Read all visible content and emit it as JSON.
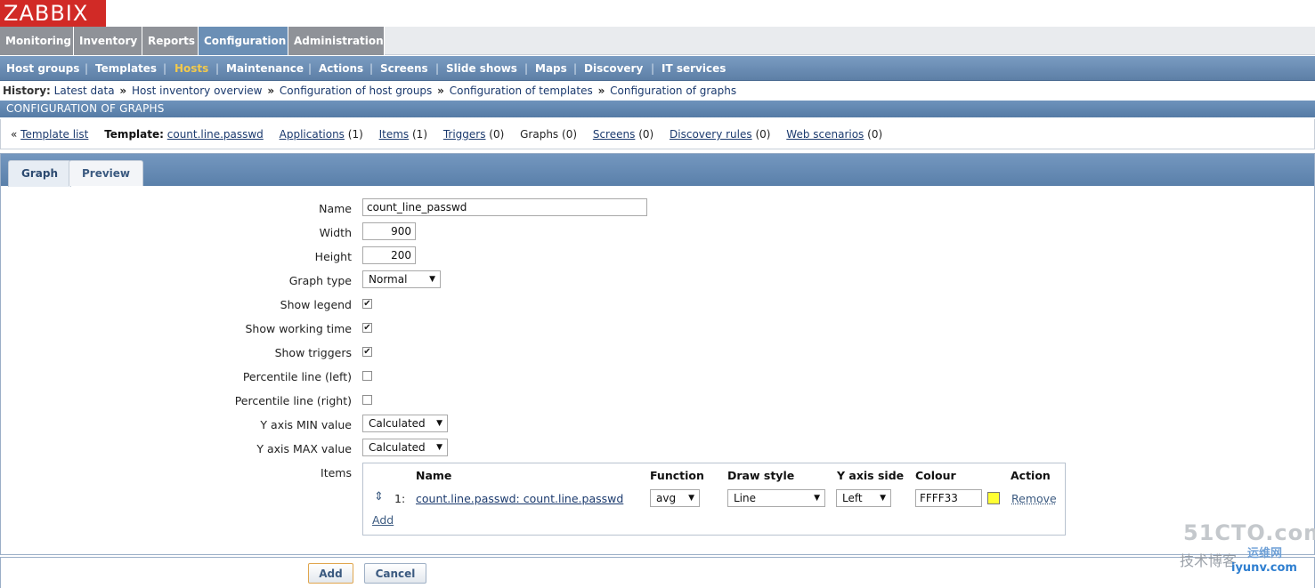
{
  "logo": "ZABBIX",
  "main_menu": [
    {
      "label": "Monitoring",
      "active": false
    },
    {
      "label": "Inventory",
      "active": false
    },
    {
      "label": "Reports",
      "active": false
    },
    {
      "label": "Configuration",
      "active": true
    },
    {
      "label": "Administration",
      "active": false
    }
  ],
  "sub_menu": [
    {
      "label": "Host groups",
      "active": false
    },
    {
      "label": "Templates",
      "active": false
    },
    {
      "label": "Hosts",
      "active": true
    },
    {
      "label": "Maintenance",
      "active": false
    },
    {
      "label": "Actions",
      "active": false
    },
    {
      "label": "Screens",
      "active": false
    },
    {
      "label": "Slide shows",
      "active": false
    },
    {
      "label": "Maps",
      "active": false
    },
    {
      "label": "Discovery",
      "active": false
    },
    {
      "label": "IT services",
      "active": false
    }
  ],
  "history": {
    "label": "History:",
    "items": [
      "Latest data",
      "Host inventory overview",
      "Configuration of host groups",
      "Configuration of templates",
      "Configuration of graphs"
    ],
    "separator": "»"
  },
  "page_title": "CONFIGURATION OF GRAPHS",
  "object_nav": {
    "back_prefix": "«",
    "template_list": "Template list",
    "template_label": "Template:",
    "template_name": "count.line.passwd",
    "applications": "Applications",
    "applications_count": "(1)",
    "items": "Items",
    "items_count": "(1)",
    "triggers": "Triggers",
    "triggers_count": "(0)",
    "graphs": "Graphs",
    "graphs_count": "(0)",
    "screens": "Screens",
    "screens_count": "(0)",
    "discovery_rules": "Discovery rules",
    "discovery_rules_count": "(0)",
    "web_scenarios": "Web scenarios",
    "web_scenarios_count": "(0)"
  },
  "tabs": [
    {
      "label": "Graph",
      "active": true
    },
    {
      "label": "Preview",
      "active": false
    }
  ],
  "form": {
    "name_label": "Name",
    "name_value": "count_line_passwd",
    "width_label": "Width",
    "width_value": "900",
    "height_label": "Height",
    "height_value": "200",
    "graph_type_label": "Graph type",
    "graph_type_value": "Normal",
    "show_legend_label": "Show legend",
    "show_legend": true,
    "show_working_time_label": "Show working time",
    "show_working_time": true,
    "show_triggers_label": "Show triggers",
    "show_triggers": true,
    "percentile_left_label": "Percentile line (left)",
    "percentile_left": false,
    "percentile_right_label": "Percentile line (right)",
    "percentile_right": false,
    "ymin_label": "Y axis MIN value",
    "ymin_value": "Calculated",
    "ymax_label": "Y axis MAX value",
    "ymax_value": "Calculated",
    "items_label": "Items"
  },
  "items_table": {
    "headers": {
      "name": "Name",
      "function": "Function",
      "draw_style": "Draw style",
      "y_axis_side": "Y axis side",
      "colour": "Colour",
      "action": "Action"
    },
    "rows": [
      {
        "index": "1:",
        "name": "count.line.passwd: count.line.passwd",
        "function": "avg",
        "draw_style": "Line",
        "y_axis_side": "Left",
        "colour": "FFFF33",
        "colour_hex": "#FFFF33",
        "action": "Remove"
      }
    ],
    "add_link": "Add"
  },
  "buttons": {
    "add": "Add",
    "cancel": "Cancel"
  },
  "watermark": {
    "line1": "51CTO.com",
    "line2": "技术博客",
    "line3": "运维网",
    "line4": "iyunv.com"
  },
  "colors": {
    "logo_red": "#d12a26",
    "menu_blue": "#6b8fb5",
    "active_sub": "#f2c94c"
  }
}
